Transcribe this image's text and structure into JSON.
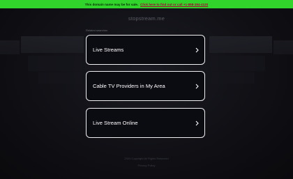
{
  "topbar": {
    "notice": "This domain name may be for sale.",
    "link": "Click here to find out or call +1-888-284-4120"
  },
  "domain": "stopstream.me",
  "related_label": "Related searches",
  "results": [
    {
      "label": "Live Streams"
    },
    {
      "label": "Cable TV Providers in My Area"
    },
    {
      "label": "Live Stream Online"
    }
  ],
  "footer": {
    "line1": "2024 Copyright  All Rights Reserved",
    "line2": "Privacy Policy"
  },
  "colors": {
    "topbar": "#31d42a",
    "background": "#101015",
    "card_border": "#f0f0f0"
  }
}
